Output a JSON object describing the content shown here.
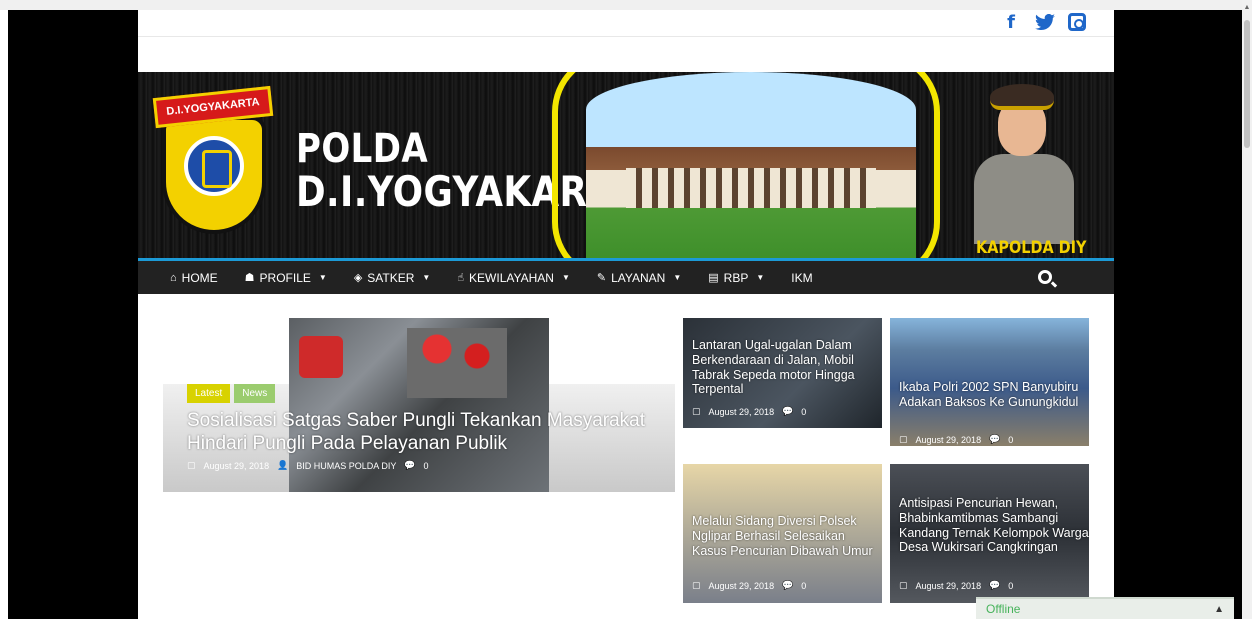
{
  "social": {
    "facebook": "f",
    "twitter": "t",
    "instagram": ""
  },
  "banner": {
    "badge_text": "D.I.YOGYAKARTA",
    "brand_line1": "POLDA",
    "brand_line2": "D.I.YOGYAKARTA",
    "officer_caption": "KAPOLDA DIY"
  },
  "nav": {
    "items": [
      {
        "icon": "home-icon",
        "label": "HOME",
        "has_dropdown": false
      },
      {
        "icon": "sitemap-icon",
        "label": "PROFILE",
        "has_dropdown": true
      },
      {
        "icon": "shield-icon",
        "label": "SATKER",
        "has_dropdown": true
      },
      {
        "icon": "thumbs-up-icon",
        "label": "KEWILAYAHAN",
        "has_dropdown": true
      },
      {
        "icon": "edit-icon",
        "label": "LAYANAN",
        "has_dropdown": true
      },
      {
        "icon": "book-icon",
        "label": "RBP",
        "has_dropdown": true
      },
      {
        "icon": "",
        "label": "IKM",
        "has_dropdown": false
      }
    ]
  },
  "featured": {
    "tags": [
      "Latest",
      "News"
    ],
    "title": "Sosialisasi Satgas Saber Pungli Tekankan Masyarakat Hindari Pungli Pada Pelayanan Publik",
    "date": "August 29, 2018",
    "author": "BID HUMAS POLDA DIY",
    "comments": "0"
  },
  "cards": [
    {
      "title": "Lantaran Ugal-ugalan Dalam Berkendaraan di Jalan, Mobil Tabrak Sepeda motor Hingga Terpental",
      "date": "August 29, 2018",
      "comments": "0"
    },
    {
      "title": "Ikaba Polri 2002 SPN Banyubiru Adakan Baksos Ke Gunungkidul",
      "date": "August 29, 2018",
      "comments": "0"
    },
    {
      "title": "Melalui Sidang Diversi Polsek Nglipar Berhasil Selesaikan Kasus Pencurian Dibawah Umur",
      "date": "August 29, 2018",
      "comments": "0"
    },
    {
      "title": "Antisipasi Pencurian Hewan, Bhabinkamtibmas Sambangi Kandang Ternak Kelompok Warga Desa Wukirsari Cangkringan",
      "date": "August 29, 2018",
      "comments": "0"
    }
  ],
  "chat": {
    "status": "Offline"
  },
  "colors": {
    "nav_bg": "#222222",
    "nav_accent": "#1c9ad6",
    "social_blue": "#1f67c9",
    "banner_yellow": "#f3d100"
  }
}
